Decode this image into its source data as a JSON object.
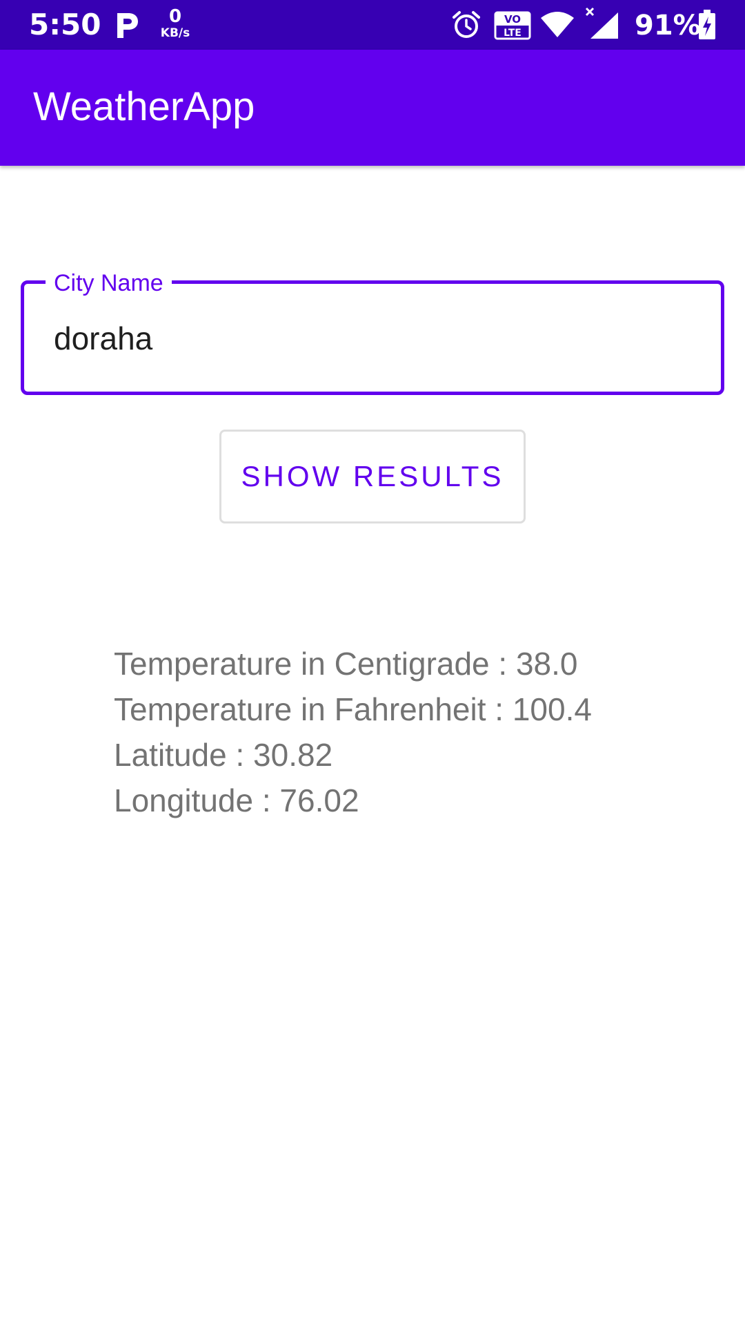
{
  "status_bar": {
    "time": "5:50",
    "net_speed_value": "0",
    "net_speed_unit": "KB/s",
    "volte_top": "VO",
    "volte_bottom": "LTE",
    "battery": "91%",
    "icons": [
      "p-icon",
      "alarm-icon",
      "volte-icon",
      "wifi-icon",
      "signal-icon",
      "battery-charging-icon"
    ]
  },
  "app_bar": {
    "title": "WeatherApp"
  },
  "city_input": {
    "label": "City Name",
    "value": "doraha"
  },
  "show_button": {
    "label": "SHOW RESULTS"
  },
  "results": {
    "centigrade": "Temperature in Centigrade : 38.0",
    "fahrenheit": "Temperature in Fahrenheit : 100.4",
    "latitude": "Latitude : 30.82",
    "longitude": "Longitude : 76.02"
  },
  "colors": {
    "status_bar": "#3700b3",
    "primary": "#6200ee",
    "results_text": "#737373"
  }
}
